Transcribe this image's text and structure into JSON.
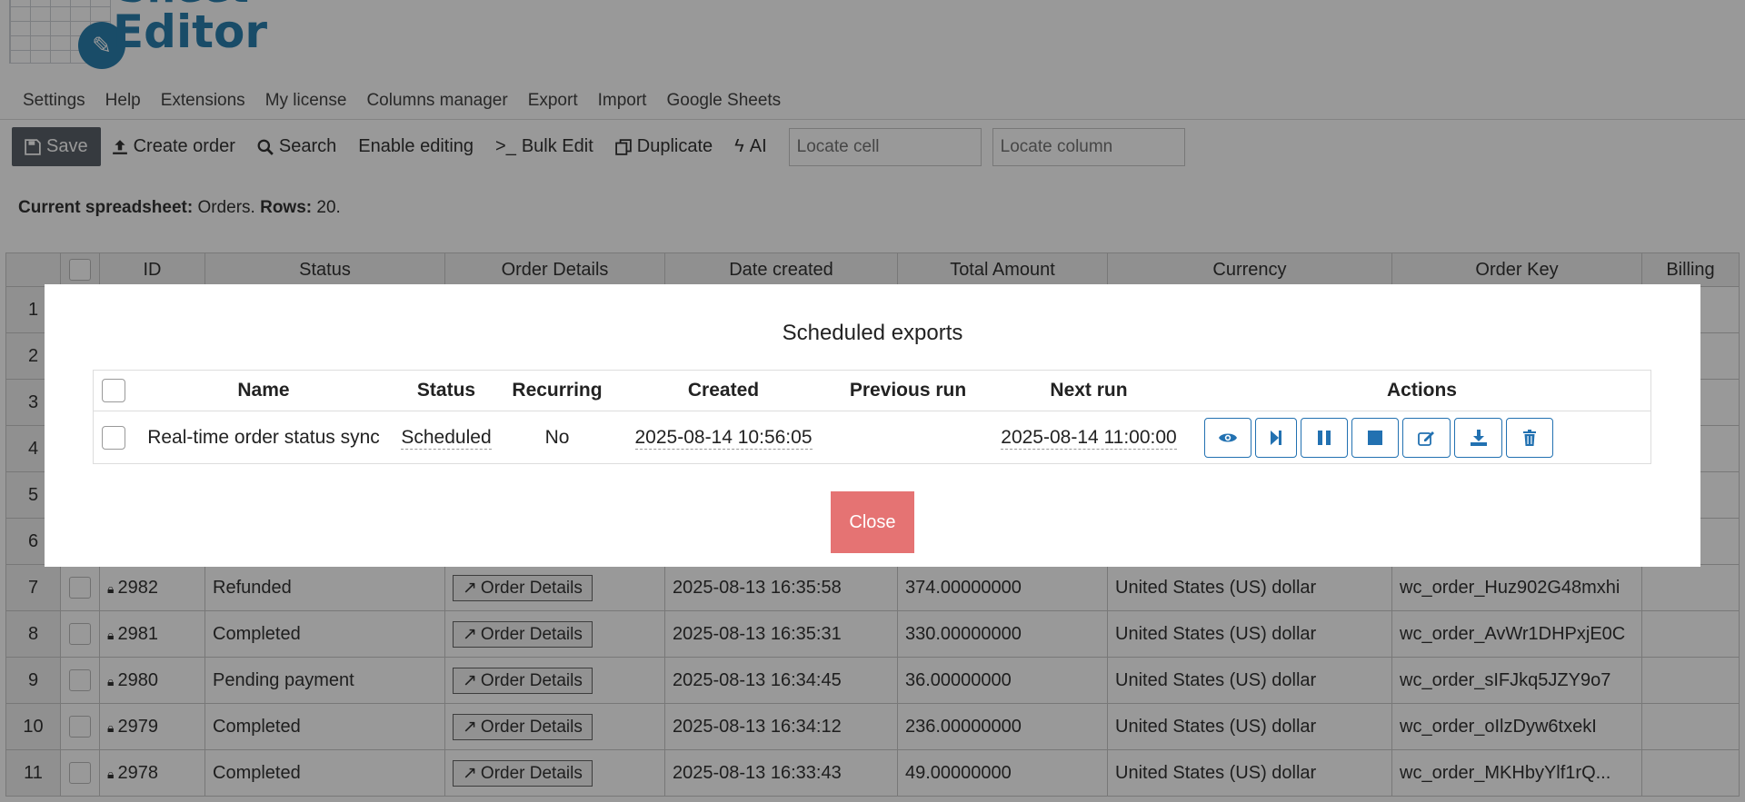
{
  "app": {
    "logo_top": "Sheet",
    "logo_bottom": "Editor"
  },
  "menu": [
    "Settings",
    "Help",
    "Extensions",
    "My license",
    "Columns manager",
    "Export",
    "Import",
    "Google Sheets"
  ],
  "toolbar": {
    "save": "Save",
    "create_order": "Create order",
    "search": "Search",
    "enable_editing": "Enable editing",
    "bulk_edit": "Bulk Edit",
    "duplicate": "Duplicate",
    "ai": "AI",
    "locate_cell_placeholder": "Locate cell",
    "locate_column_placeholder": "Locate column"
  },
  "info": {
    "label1": "Current spreadsheet:",
    "value1": "Orders.",
    "label2": "Rows:",
    "value2": "20."
  },
  "grid": {
    "headers": [
      "ID",
      "Status",
      "Order Details",
      "Date created",
      "Total Amount",
      "Currency",
      "Order Key",
      "Billing"
    ],
    "hidden_rows": [
      "1",
      "2",
      "3",
      "4",
      "5",
      "6"
    ],
    "rows": [
      {
        "n": "7",
        "id": "2982",
        "status": "Refunded",
        "details": "Order Details",
        "date": "2025-08-13 16:35:58",
        "total": "374.00000000",
        "currency": "United States (US) dollar",
        "key": "wc_order_Huz902G48mxhi"
      },
      {
        "n": "8",
        "id": "2981",
        "status": "Completed",
        "details": "Order Details",
        "date": "2025-08-13 16:35:31",
        "total": "330.00000000",
        "currency": "United States (US) dollar",
        "key": "wc_order_AvWr1DHPxjE0C"
      },
      {
        "n": "9",
        "id": "2980",
        "status": "Pending payment",
        "details": "Order Details",
        "date": "2025-08-13 16:34:45",
        "total": "36.00000000",
        "currency": "United States (US) dollar",
        "key": "wc_order_sIFJkq5JZY9o7"
      },
      {
        "n": "10",
        "id": "2979",
        "status": "Completed",
        "details": "Order Details",
        "date": "2025-08-13 16:34:12",
        "total": "236.00000000",
        "currency": "United States (US) dollar",
        "key": "wc_order_oIlzDyw6txekI"
      },
      {
        "n": "11",
        "id": "2978",
        "status": "Completed",
        "details": "Order Details",
        "date": "2025-08-13 16:33:43",
        "total": "49.00000000",
        "currency": "United States (US) dollar",
        "key": "wc_order_MKHbyYlf1rQ..."
      }
    ]
  },
  "modal": {
    "title": "Scheduled exports",
    "headers": [
      "Name",
      "Status",
      "Recurring",
      "Created",
      "Previous run",
      "Next run",
      "Actions"
    ],
    "row": {
      "name": "Real-time order status sync",
      "status": "Scheduled",
      "recurring": "No",
      "created": "2025-08-14 10:56:05",
      "previous_run": "",
      "next_run": "2025-08-14 11:00:00"
    },
    "action_icons": [
      "eye-icon",
      "step-forward-icon",
      "pause-icon",
      "stop-icon",
      "edit-icon",
      "download-icon",
      "trash-icon"
    ],
    "close": "Close",
    "colors": {
      "accent": "#2271b1",
      "close_bg": "#e57373"
    }
  }
}
